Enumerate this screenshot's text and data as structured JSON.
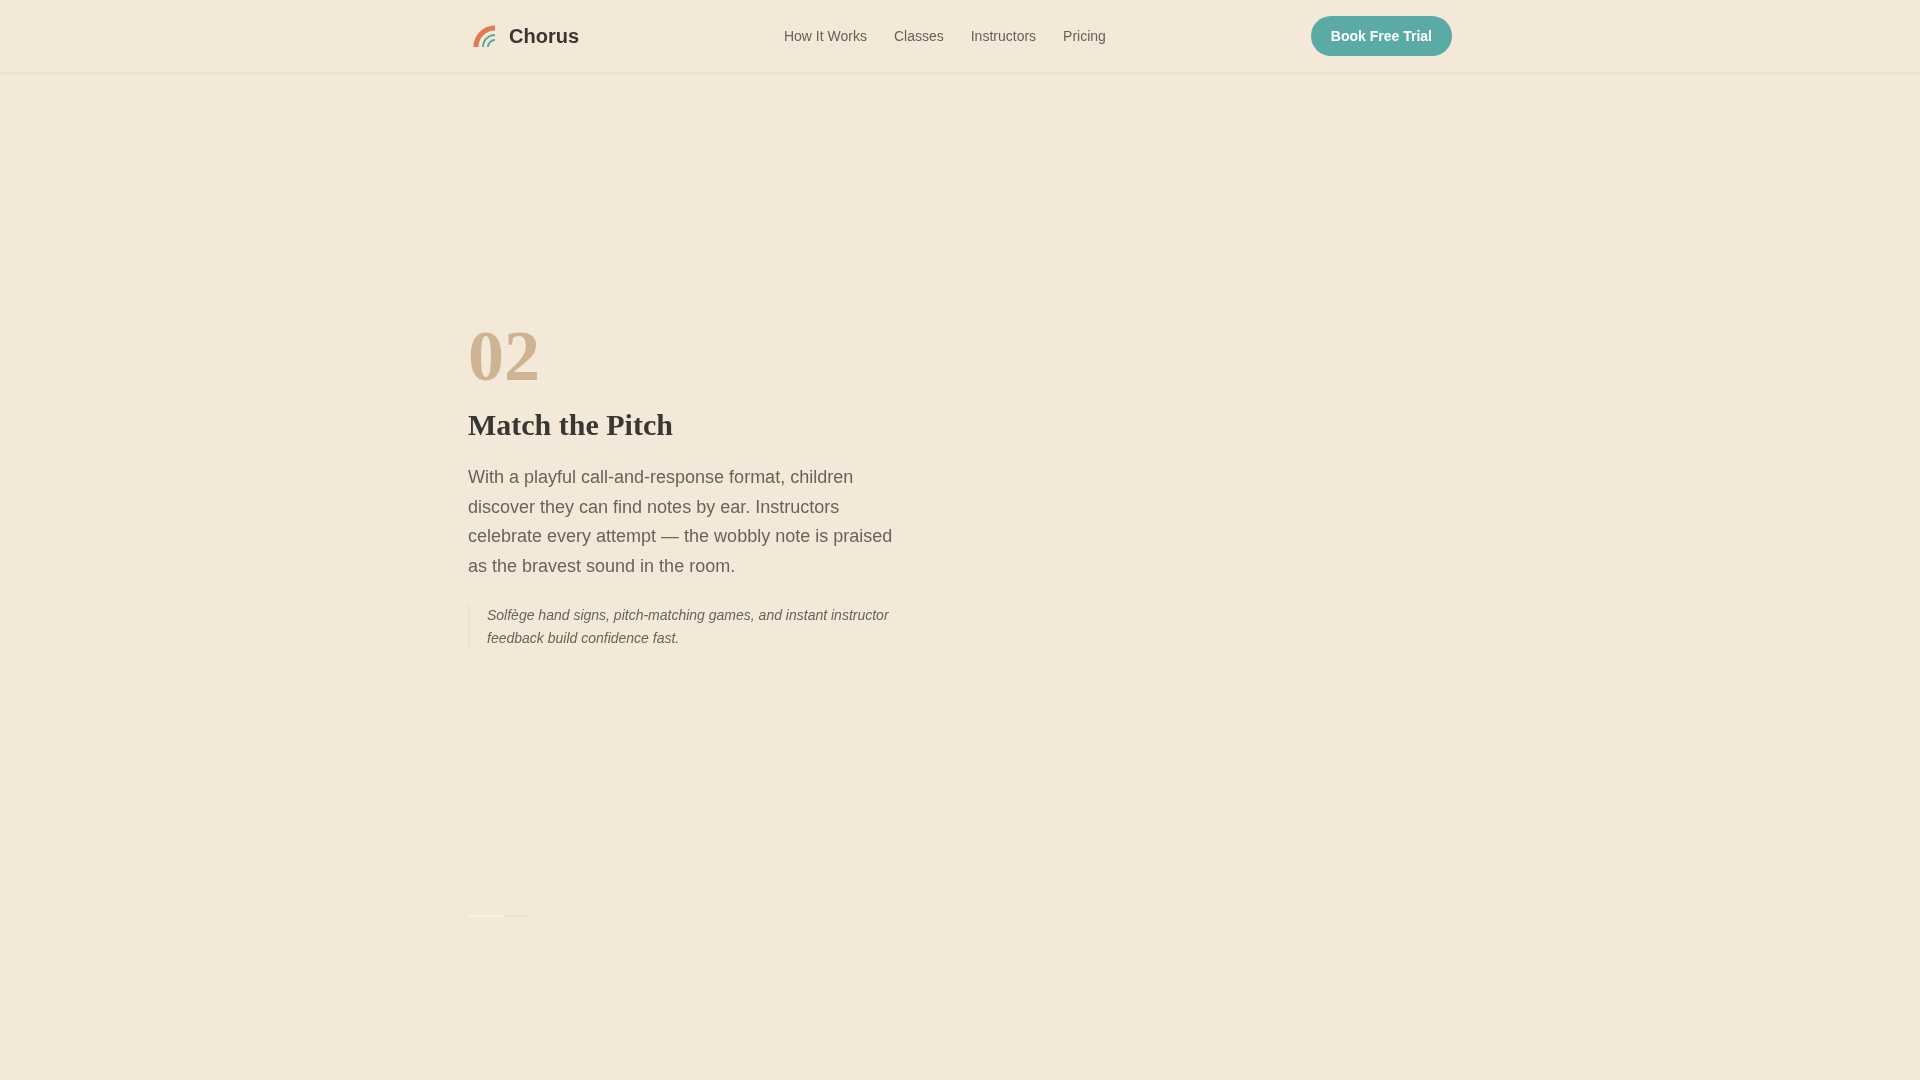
{
  "header": {
    "brand": "Chorus",
    "nav": [
      "How It Works",
      "Classes",
      "Instructors",
      "Pricing"
    ],
    "cta": "Book Free Trial"
  },
  "step": {
    "number": "02",
    "title": "Match the Pitch",
    "body": "With a playful call-and-response format, children discover they can find notes by ear. Instructors celebrate every attempt — the wobbly note is praised as the bravest sound in the room.",
    "note": "Solfège hand signs, pitch-matching games, and instant instructor feedback build confidence fast."
  }
}
